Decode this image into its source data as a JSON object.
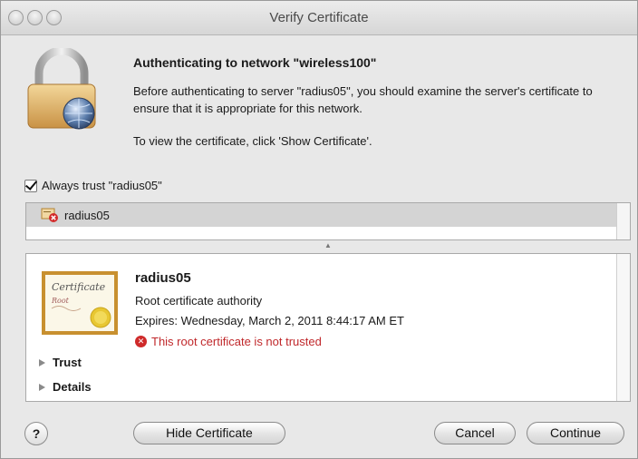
{
  "window": {
    "title": "Verify Certificate"
  },
  "message": {
    "heading": "Authenticating to network \"wireless100\"",
    "body": "Before authenticating to server \"radius05\", you should examine the server's certificate to ensure that it is appropriate for this network.",
    "hint": "To view the certificate, click 'Show Certificate'."
  },
  "trust_checkbox": {
    "label": "Always trust \"radius05\"",
    "checked": true
  },
  "cert_list": {
    "items": [
      {
        "label": "radius05"
      }
    ]
  },
  "cert_detail": {
    "name": "radius05",
    "type": "Root certificate authority",
    "expires": "Expires: Wednesday, March 2, 2011 8:44:17 AM ET",
    "warning": "This root certificate is not trusted",
    "image_text": "Certificate",
    "image_subtext": "Root",
    "sections": [
      "Trust",
      "Details"
    ]
  },
  "buttons": {
    "help": "?",
    "hide": "Hide Certificate",
    "cancel": "Cancel",
    "continue": "Continue"
  },
  "colors": {
    "warning": "#c0282b",
    "selection": "#d4d4d4"
  }
}
